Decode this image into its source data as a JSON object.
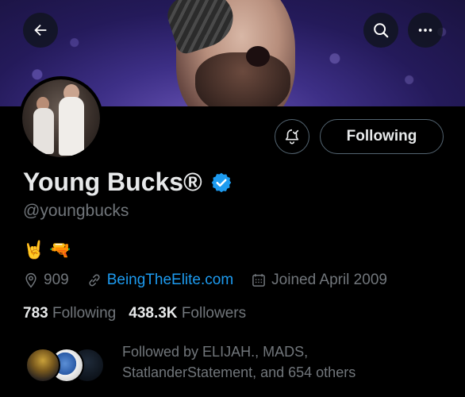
{
  "header": {
    "back_icon": "arrow-left-icon",
    "search_icon": "search-icon",
    "more_icon": "more-horizontal-icon"
  },
  "profile": {
    "display_name": "Young Bucks®",
    "verified_icon": "verified-badge-icon",
    "handle": "@youngbucks",
    "bio_emojis": [
      "🤘",
      "🔫"
    ],
    "location": "909",
    "website": "BeingTheElite.com",
    "joined": "Joined April 2009",
    "following_count": "783",
    "following_label": "Following",
    "followers_count": "438.3K",
    "followers_label": "Followers",
    "followed_by_line1": "Followed by ELIJAH., MADS,",
    "followed_by_line2": "StatlanderStatement, and 654 others"
  },
  "actions": {
    "notifications_icon": "bell-check-icon",
    "following_button": "Following"
  },
  "colors": {
    "background": "#000000",
    "text_primary": "#e7e9ea",
    "text_secondary": "#71767b",
    "accent_blue": "#1d9bf0",
    "border": "#536471"
  }
}
